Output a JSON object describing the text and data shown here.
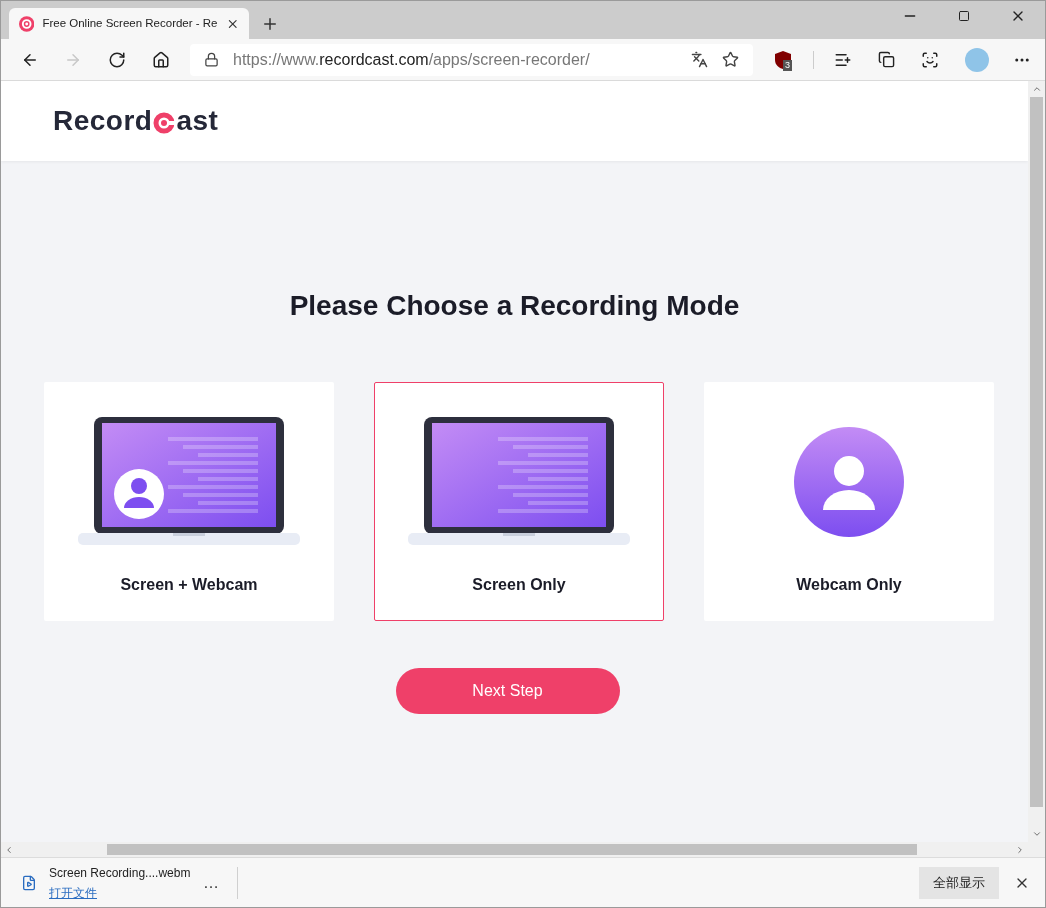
{
  "browser": {
    "tab": {
      "title": "Free Online Screen Recorder - Re",
      "selected": true
    },
    "url": {
      "scheme": "https://www.",
      "domain": "recordcast.com",
      "path": "/apps/screen-recorder/"
    },
    "extension_badge": "3"
  },
  "logo": {
    "before": "Record",
    "after": "ast"
  },
  "heading": "Please Choose a Recording Mode",
  "modes": [
    {
      "label": "Screen + Webcam",
      "kind": "screen-webcam",
      "selected": false
    },
    {
      "label": "Screen Only",
      "kind": "screen",
      "selected": true
    },
    {
      "label": "Webcam Only",
      "kind": "webcam",
      "selected": false
    }
  ],
  "next_button": "Next Step",
  "download_bar": {
    "file": "Screen Recording....webm",
    "open_link": "打开文件",
    "more": "…",
    "show_all": "全部显示"
  }
}
